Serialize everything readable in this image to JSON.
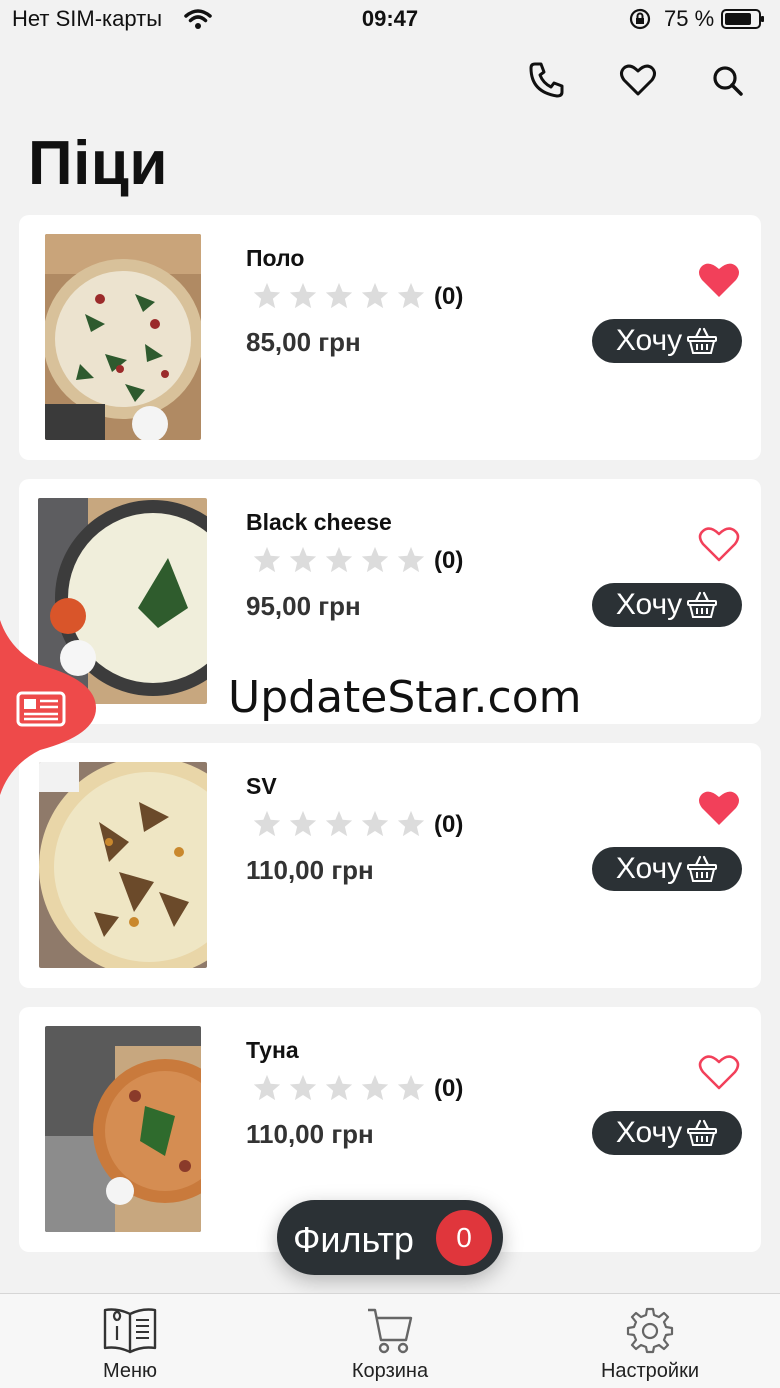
{
  "status_bar": {
    "carrier": "Нет SIM-карты",
    "time": "09:47",
    "battery": "75 %"
  },
  "top_icons": [
    "phone-icon",
    "heart-icon",
    "search-icon"
  ],
  "page": {
    "title": "Піци"
  },
  "products": [
    {
      "name": "Поло",
      "rating_count": "(0)",
      "price": "85,00 грн",
      "favorite": true,
      "button": "Хочу"
    },
    {
      "name": "Black cheese",
      "rating_count": "(0)",
      "price": "95,00 грн",
      "favorite": false,
      "button": "Хочу"
    },
    {
      "name": "SV",
      "rating_count": "(0)",
      "price": "110,00 грн",
      "favorite": true,
      "button": "Хочу"
    },
    {
      "name": "Туна",
      "rating_count": "(0)",
      "price": "110,00 грн",
      "favorite": false,
      "button": "Хочу"
    }
  ],
  "watermark": "UpdateStar.com",
  "filter": {
    "label": "Фильтр",
    "count": "0"
  },
  "tabbar": {
    "items": [
      {
        "label": "Меню",
        "icon": "menu-book-icon"
      },
      {
        "label": "Корзина",
        "icon": "cart-icon"
      },
      {
        "label": "Настройки",
        "icon": "gear-icon"
      }
    ]
  },
  "colors": {
    "accent": "#f2405a",
    "dark": "#2b3135",
    "badge": "#e0363c",
    "side_tab": "#ee4a4a"
  }
}
